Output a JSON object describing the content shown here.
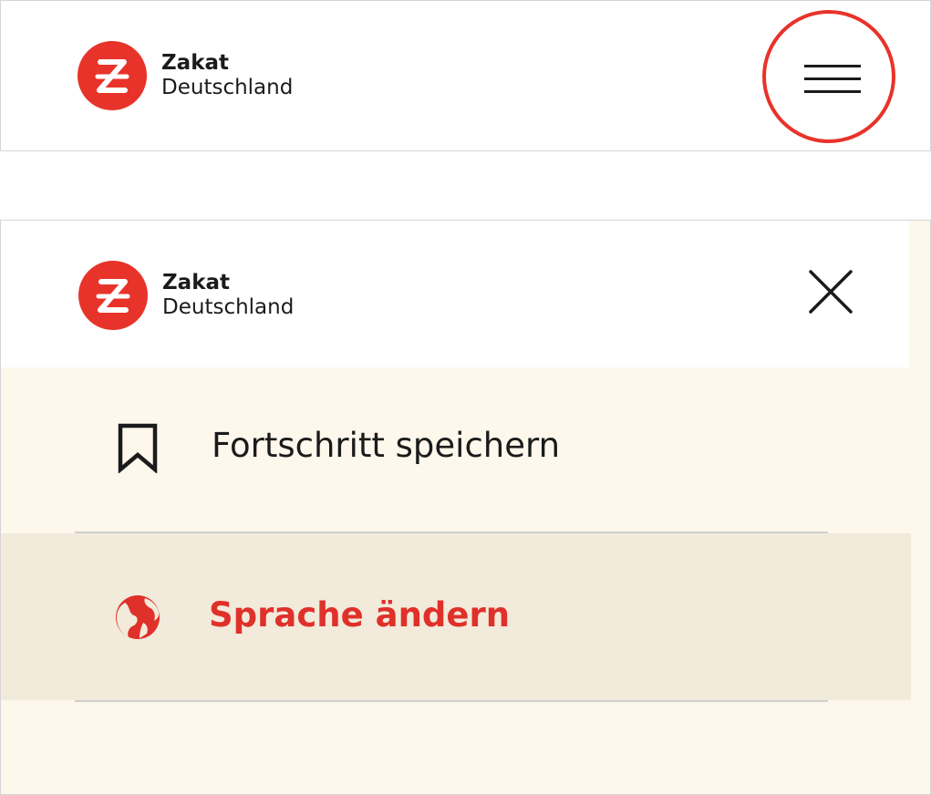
{
  "brand": {
    "name": "Zakat",
    "subtitle": "Deutschland",
    "color": "#e8332a"
  },
  "top_header": {
    "menu_icon": "hamburger-menu-icon",
    "highlight_color": "#e8332a"
  },
  "menu": {
    "close_icon": "close-icon",
    "background": "#fdf7ec",
    "items": [
      {
        "label": "Fortschritt speichern",
        "icon": "bookmark-icon",
        "active": false
      },
      {
        "label": "Sprache ändern",
        "icon": "globe-icon",
        "active": true,
        "color": "#e0302a"
      }
    ]
  }
}
